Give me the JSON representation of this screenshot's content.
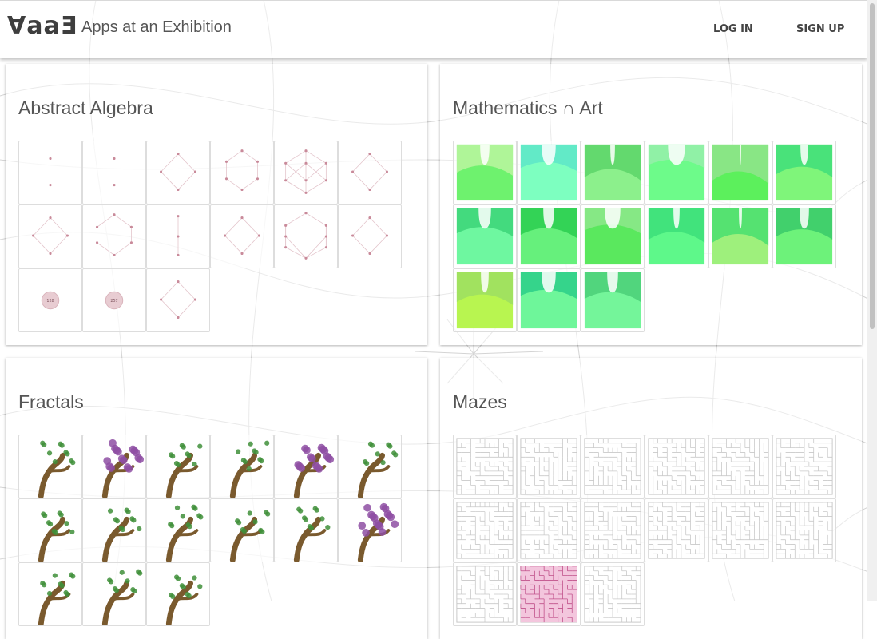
{
  "header": {
    "logo": "∀aaƎ",
    "title": "Apps at an Exhibition",
    "login_label": "LOG IN",
    "signup_label": "SIGN UP"
  },
  "sections": [
    {
      "title": "Abstract Algebra",
      "kind": "algebra",
      "count": 15
    },
    {
      "title": "Mathematics ∩ Art",
      "kind": "art",
      "count": 15
    },
    {
      "title": "Fractals",
      "kind": "fractal",
      "count": 15
    },
    {
      "title": "Mazes",
      "kind": "maze",
      "count": 15
    }
  ],
  "algebra_badges": [
    "128",
    "257"
  ],
  "colors": {
    "algebra_node": "#c98a9a",
    "algebra_badge": "#e8ccd2",
    "art_green": "#6be86b",
    "tree_trunk": "#7a5a2e",
    "maze_line": "#c8c8c8"
  }
}
